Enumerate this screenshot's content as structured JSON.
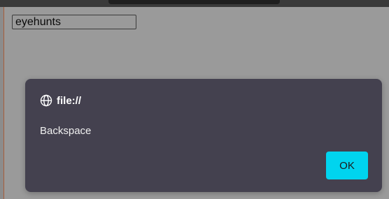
{
  "input": {
    "value": "eyehunts"
  },
  "dialog": {
    "origin": "file://",
    "message": "Backspace",
    "ok_label": "OK"
  },
  "colors": {
    "page_background": "#9a9a9a",
    "dialog_background": "#44414f",
    "ok_button": "#00d4ef"
  },
  "icons": {
    "origin_icon": "globe-icon"
  }
}
